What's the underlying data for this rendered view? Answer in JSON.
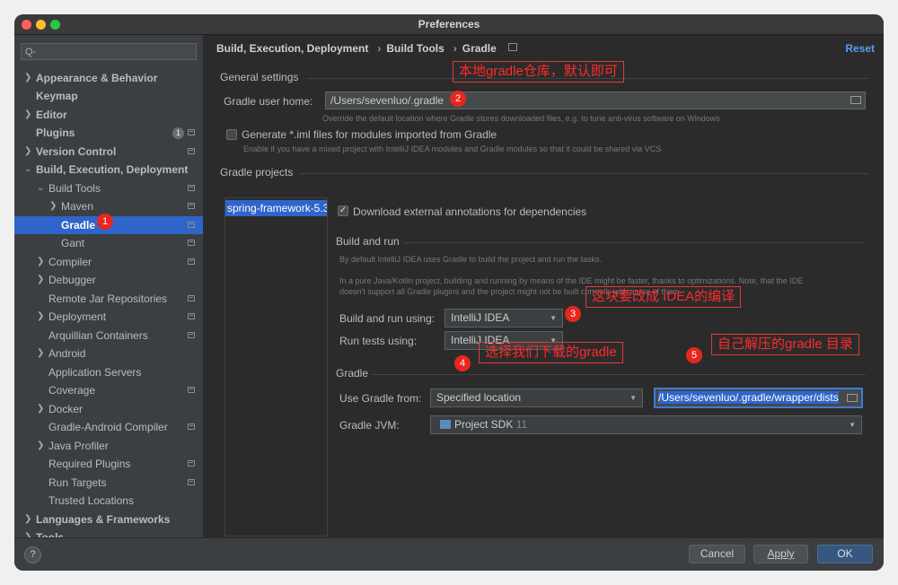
{
  "window": {
    "title": "Preferences"
  },
  "search": {
    "placeholder": "Q-"
  },
  "sidebar": {
    "items": [
      {
        "label": "Appearance & Behavior"
      },
      {
        "label": "Keymap"
      },
      {
        "label": "Editor"
      },
      {
        "label": "Plugins",
        "badge": "1"
      },
      {
        "label": "Version Control"
      },
      {
        "label": "Build, Execution, Deployment"
      },
      {
        "label": "Build Tools"
      },
      {
        "label": "Maven"
      },
      {
        "label": "Gradle"
      },
      {
        "label": "Gant"
      },
      {
        "label": "Compiler"
      },
      {
        "label": "Debugger"
      },
      {
        "label": "Remote Jar Repositories"
      },
      {
        "label": "Deployment"
      },
      {
        "label": "Arquillian Containers"
      },
      {
        "label": "Android"
      },
      {
        "label": "Application Servers"
      },
      {
        "label": "Coverage"
      },
      {
        "label": "Docker"
      },
      {
        "label": "Gradle-Android Compiler"
      },
      {
        "label": "Java Profiler"
      },
      {
        "label": "Required Plugins"
      },
      {
        "label": "Run Targets"
      },
      {
        "label": "Trusted Locations"
      },
      {
        "label": "Languages & Frameworks"
      },
      {
        "label": "Tools"
      }
    ]
  },
  "breadcrumb": {
    "part1": "Build, Execution, Deployment",
    "part2": "Build Tools",
    "part3": "Gradle"
  },
  "header": {
    "reset_label": "Reset"
  },
  "general": {
    "title": "General settings",
    "user_home_label": "Gradle user home:",
    "user_home_value": "/Users/sevenluo/.gradle",
    "user_home_hint": "Override the default location where Gradle stores downloaded files, e.g. to tune anti-virus software on Windows",
    "iml_label": "Generate *.iml files for modules imported from Gradle",
    "iml_hint": "Enable if you have a mixed project with IntelliJ IDEA modules and Gradle modules so that it could be shared via VCS"
  },
  "projects": {
    "title": "Gradle projects",
    "items": [
      "spring-framework-5.3"
    ],
    "download_annotations_label": "Download external annotations for dependencies"
  },
  "build_run": {
    "title": "Build and run",
    "hint1": "By default IntelliJ IDEA uses Gradle to build the project and run the tasks.",
    "hint2": "In a pure Java/Kotlin project, building and running by means of the IDE might be faster, thanks to optimizations. Note, that the IDE",
    "hint3": "doesn't support all Gradle plugins and the project might not be built correctly with some of them.",
    "build_using_label": "Build and run using:",
    "build_using_value": "IntelliJ IDEA",
    "tests_using_label": "Run tests using:",
    "tests_using_value": "IntelliJ IDEA"
  },
  "gradle": {
    "title": "Gradle",
    "use_from_label": "Use Gradle from:",
    "use_from_value": "Specified location",
    "location_value": "/Users/sevenluo/.gradle/wrapper/dists",
    "jvm_label": "Gradle JVM:",
    "jvm_value": "Project SDK",
    "jvm_version": "11"
  },
  "annotations": {
    "a1": "本地gradle仓库，默认即可",
    "a2": "这块要改成 IDEA的编译",
    "a3": "选择我们下载的gradle",
    "a4": "自己解压的gradle 目录",
    "n1": "1",
    "n2": "2",
    "n3": "3",
    "n4": "4",
    "n5": "5"
  },
  "footer": {
    "help": "?",
    "cancel": "Cancel",
    "apply": "Apply",
    "ok": "OK"
  },
  "colors": {
    "accent": "#2f65ca",
    "annotation": "#e8261f",
    "link": "#589df6"
  }
}
